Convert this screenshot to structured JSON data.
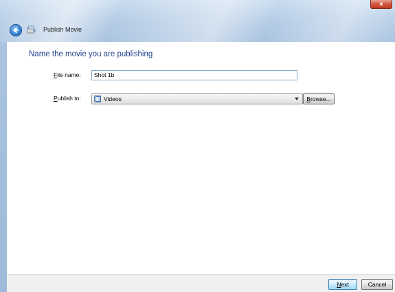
{
  "window": {
    "title": "Publish Movie",
    "close_glyph": "x"
  },
  "content": {
    "heading": "Name the movie you are publishing"
  },
  "form": {
    "file_name_label_accel": "F",
    "file_name_label_rest": "ile name:",
    "file_name_value": "Shot 1b",
    "publish_to_label_accel": "P",
    "publish_to_label_rest": "ublish to:",
    "publish_to_value": "Videos",
    "browse_label_accel": "B",
    "browse_label_rest": "rowse..."
  },
  "footer": {
    "next_label_accel": "N",
    "next_label_rest": "ext",
    "cancel_label": "Cancel"
  },
  "colors": {
    "heading": "#1e3f8f",
    "glass": "#b6cde6",
    "close": "#c23a26",
    "accent": "#3c7fb1"
  },
  "icons": {
    "back": "back-arrow-icon",
    "app": "movie-maker-icon",
    "folder": "videos-folder-icon",
    "dropdown": "chevron-down-icon"
  }
}
